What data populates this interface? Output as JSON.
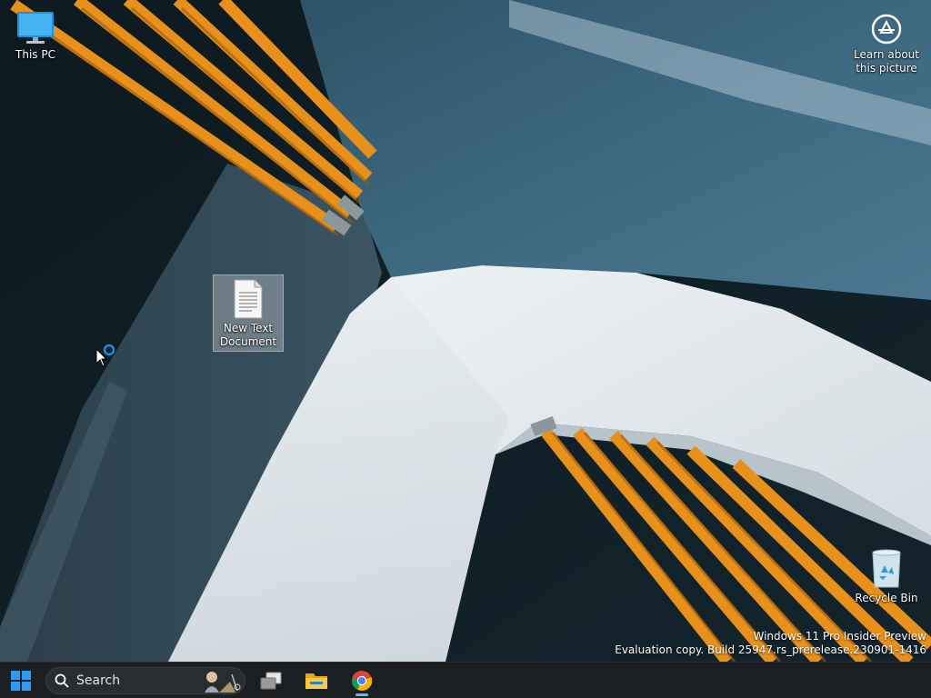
{
  "desktop": {
    "icons": {
      "this_pc": "This PC",
      "learn": "Learn about this picture",
      "text_doc": "New Text Document",
      "recycle_bin": "Recycle Bin"
    },
    "watermark": {
      "line1": "Windows 11 Pro Insider Preview",
      "line2": "Evaluation copy. Build 25947.rs_prerelease.230901-1416"
    }
  },
  "taskbar": {
    "search_label": "Search",
    "pinned": [
      "start-icon",
      "task-view-icon",
      "file-explorer-icon",
      "chrome-icon"
    ],
    "active_app": "Google Chrome"
  },
  "colors": {
    "taskbar_bg": "#1c1f22",
    "accent": "#4cc2ff",
    "start_blue": "#2b9bf4"
  }
}
